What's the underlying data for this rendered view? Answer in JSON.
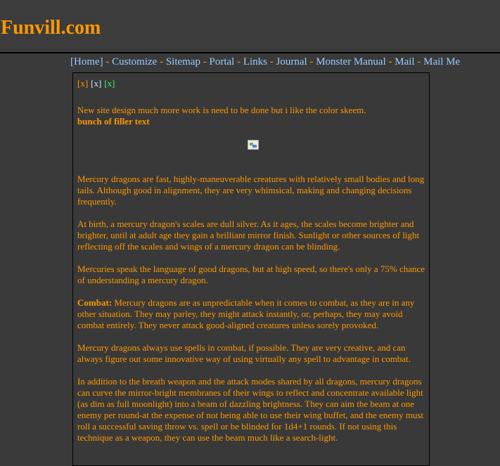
{
  "site": {
    "title": "Funvill.com"
  },
  "nav": {
    "items": [
      {
        "label": "[Home]"
      },
      {
        "label": "Customize"
      },
      {
        "label": "Sitemap"
      },
      {
        "label": "Portal"
      },
      {
        "label": "Links"
      },
      {
        "label": "Journal"
      },
      {
        "label": "Monster Manual"
      },
      {
        "label": "Mail"
      },
      {
        "label": "Mail Me"
      }
    ],
    "separator": " - "
  },
  "controls": [
    {
      "label": "[x]",
      "color": "#ff9900"
    },
    {
      "label": "[x]",
      "color": "#cfe6ff"
    },
    {
      "label": "[x]",
      "color": "#33ff66"
    }
  ],
  "content": {
    "intro": "New site design much more work is need to be done but i like the color skeem.",
    "intro_bold": "bunch of filler text",
    "image_icon": "broken-image-icon",
    "paragraphs": [
      {
        "text": "Mercury dragons are fast, highly-maneuverable creatures with relatively small bodies and long tails. Although good in alignment, they are very whimsical, making and changing decisions frequently."
      },
      {
        "text": "At birth, a mercury dragon's scales are dull silver. As it ages, the scales become brighter and brighter, until at adult age they gain a brilliant mirror finish. Sunlight or other sources of light reflecting off the scales and wings of a mercury dragon can be blinding."
      },
      {
        "text": "Mercuries speak the language of good dragons, but at high speed, so there's only a 75% chance of understanding a mercury dragon."
      },
      {
        "label": "Combat:",
        "text": " Mercury dragons are as unpredictable when it comes to combat, as they are in any other situation. They may parley, they might attack instantly, or, perhaps, they may avoid combat entirely. They never attack good-aligned creatures unless sorely provoked."
      },
      {
        "text": "Mercury dragons always use spells in combat, if possible. They are very creative, and can always figure out some innovative way of using virtually any spell to advantage in combat."
      },
      {
        "text": "In addition to the breath weapon and the attack modes shared by all dragons, mercury dragons can curve the mirror-bright membranes of their wings to reflect and concentrate available light (as dim as full moonlight) into a beam of dazzling brightness. They can aim the beam at one enemy per round-at the expense of not being able to use their wing buffet, and the enemy must roll a successful saving throw vs. spell or be blinded for 1d4+1 rounds. If not using this technique as a weapon, they can use the beam much like a search-light."
      }
    ]
  },
  "colors": {
    "accent": "#ff9900",
    "link": "#99ccff",
    "background": "#3a3a3a"
  }
}
